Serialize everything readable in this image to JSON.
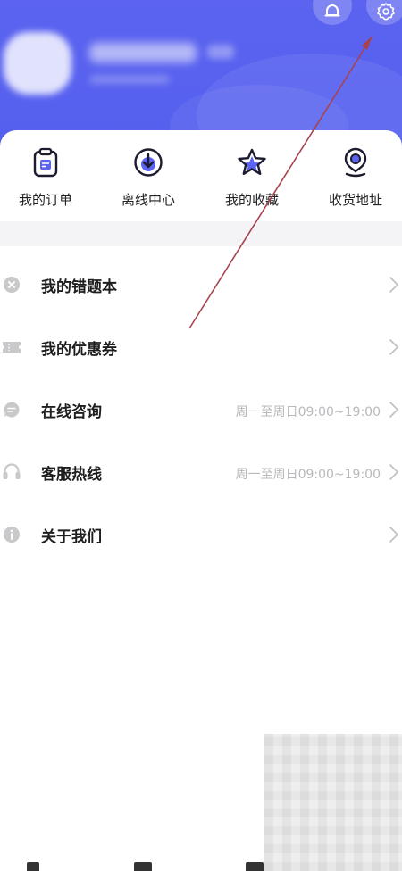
{
  "header": {
    "bg_color": "#5b63f0",
    "bell_icon": "bell-icon",
    "settings_icon": "gear-icon"
  },
  "shortcuts": [
    {
      "label": "我的订单",
      "icon": "clipboard-icon"
    },
    {
      "label": "离线中心",
      "icon": "download-circle-icon"
    },
    {
      "label": "我的收藏",
      "icon": "star-icon"
    },
    {
      "label": "收货地址",
      "icon": "location-pin-icon"
    }
  ],
  "menu": {
    "items": [
      {
        "label": "我的错题本",
        "hours": "",
        "icon": "x-circle-icon"
      },
      {
        "label": "我的优惠券",
        "hours": "",
        "icon": "ticket-icon"
      },
      {
        "label": "在线咨询",
        "hours": "周一至周日09:00~19:00",
        "icon": "chat-bubble-icon"
      },
      {
        "label": "客服热线",
        "hours": "周一至周日09:00~19:00",
        "icon": "headset-icon"
      },
      {
        "label": "关于我们",
        "hours": "",
        "icon": "info-circle-icon"
      }
    ]
  },
  "annotation": {
    "color": "#a8424c",
    "icon": "arrow-annotation"
  }
}
